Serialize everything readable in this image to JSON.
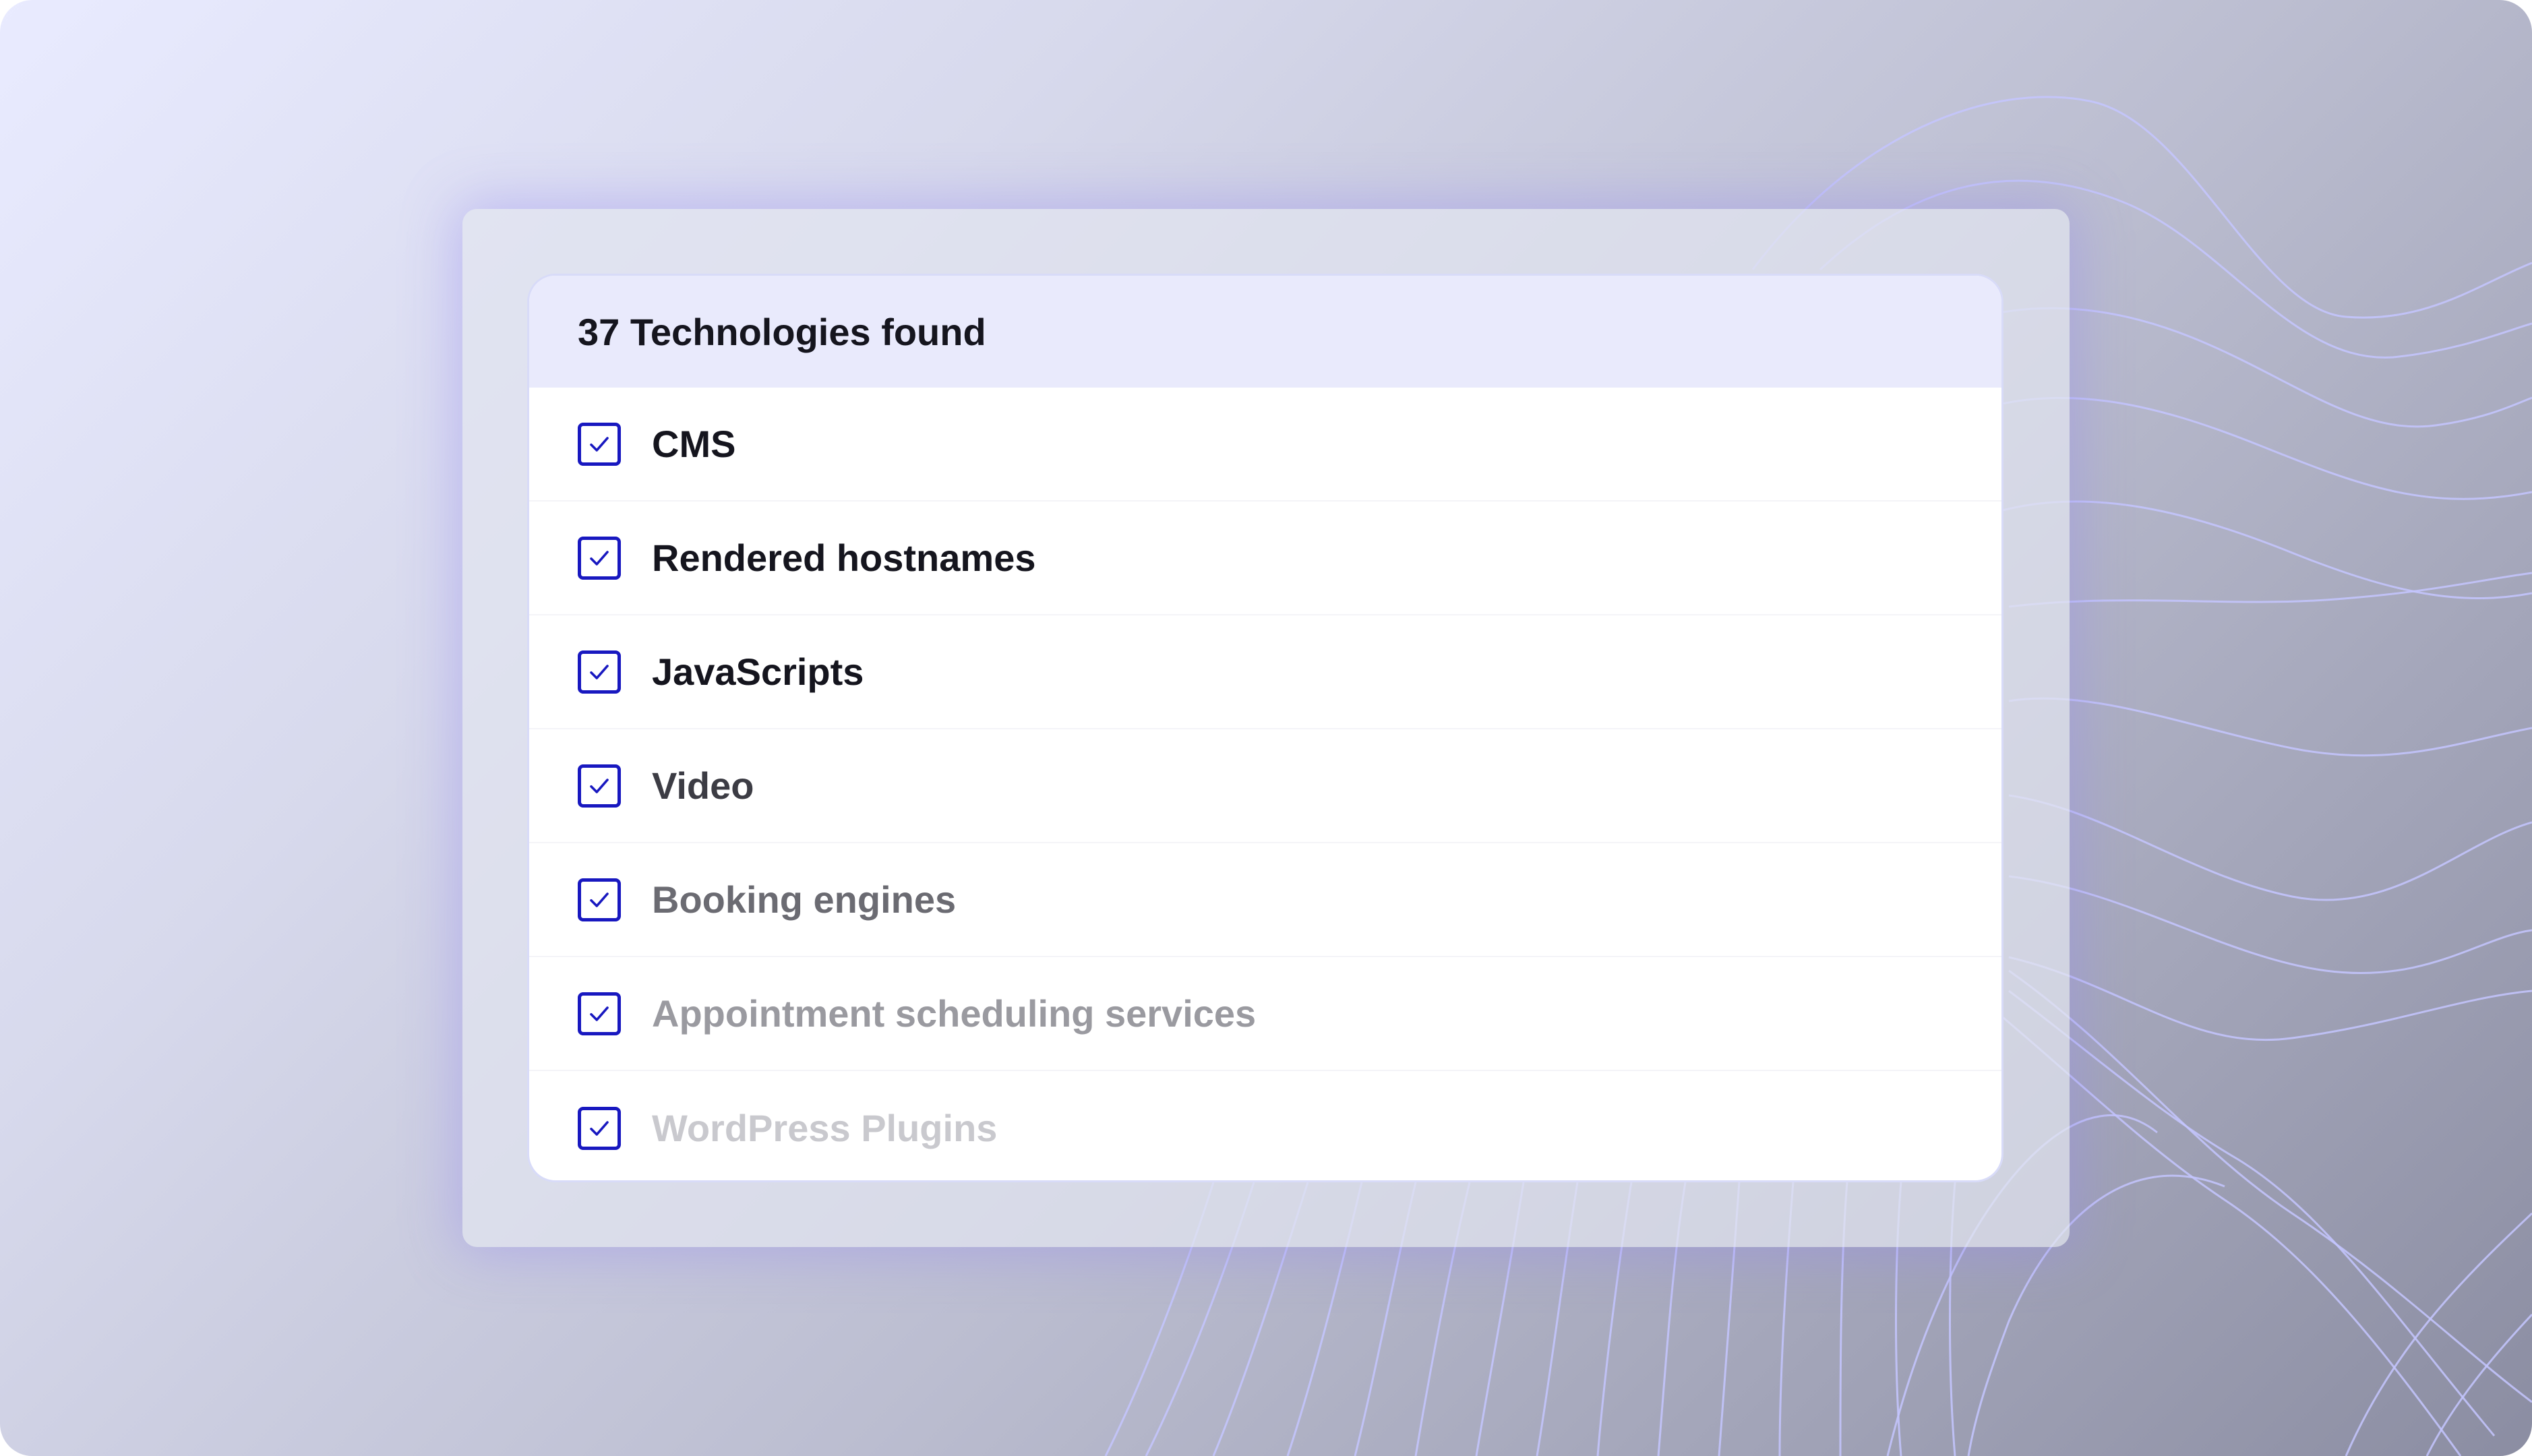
{
  "panel": {
    "title": "37 Technologies found",
    "items": [
      {
        "label": "CMS",
        "checked": true,
        "text_color": "#15151e"
      },
      {
        "label": "Rendered hostnames",
        "checked": true,
        "text_color": "#15151e"
      },
      {
        "label": "JavaScripts",
        "checked": true,
        "text_color": "#15151e"
      },
      {
        "label": "Video",
        "checked": true,
        "text_color": "#3c3c44"
      },
      {
        "label": "Booking engines",
        "checked": true,
        "text_color": "#6b6b72"
      },
      {
        "label": "Appointment scheduling services",
        "checked": true,
        "text_color": "#9a9aa0"
      },
      {
        "label": "WordPress Plugins",
        "checked": true,
        "text_color": "#c9c9ce"
      }
    ]
  },
  "colors": {
    "accent": "#1818c0",
    "header_background": "#e9eafc",
    "wave_lines": "#c4c6ff"
  },
  "icons": {
    "checkbox": "checkmark-icon"
  }
}
